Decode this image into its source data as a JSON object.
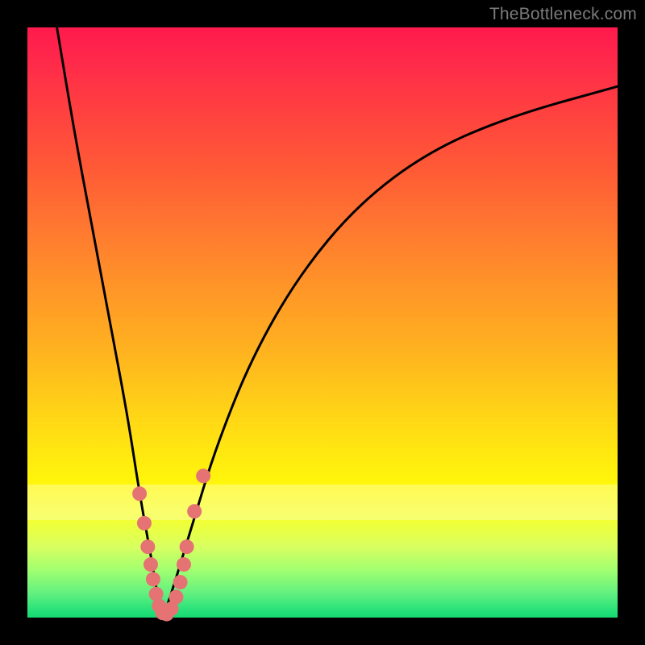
{
  "watermark": "TheBottleneck.com",
  "colors": {
    "frame_bg": "#000000",
    "curve_stroke": "#000000",
    "marker_fill": "#e57373",
    "marker_stroke": "#cc5a5a",
    "gradient_top": "#ff1a4d",
    "gradient_bottom": "#18d870"
  },
  "chart_data": {
    "type": "line",
    "title": "",
    "xlabel": "",
    "ylabel": "",
    "xlim": [
      0,
      100
    ],
    "ylim": [
      0,
      100
    ],
    "notes": "V-shaped bottleneck curve. x is a normalized hardware-balance axis (0–100). y is bottleneck percentage (0 at bottom = no bottleneck, 100 at top = severe). Minimum at roughly x≈23. Values estimated visually.",
    "series": [
      {
        "name": "left-branch",
        "x": [
          5,
          8,
          11,
          14,
          17,
          19,
          21,
          22,
          23
        ],
        "values": [
          100,
          82,
          66,
          50,
          34,
          21,
          10,
          4,
          0
        ]
      },
      {
        "name": "right-branch",
        "x": [
          23,
          25,
          28,
          32,
          38,
          46,
          56,
          68,
          82,
          100
        ],
        "values": [
          0,
          6,
          16,
          29,
          44,
          58,
          70,
          79,
          85,
          90
        ]
      }
    ],
    "markers": {
      "name": "highlighted-points",
      "comment": "salmon-colored dots clustered near the trough on both branches",
      "points": [
        {
          "x": 19.0,
          "y": 21
        },
        {
          "x": 19.8,
          "y": 16
        },
        {
          "x": 20.4,
          "y": 12
        },
        {
          "x": 20.9,
          "y": 9
        },
        {
          "x": 21.3,
          "y": 6.5
        },
        {
          "x": 21.8,
          "y": 4
        },
        {
          "x": 22.3,
          "y": 2
        },
        {
          "x": 22.9,
          "y": 0.8
        },
        {
          "x": 23.6,
          "y": 0.6
        },
        {
          "x": 24.4,
          "y": 1.5
        },
        {
          "x": 25.2,
          "y": 3.5
        },
        {
          "x": 25.9,
          "y": 6
        },
        {
          "x": 26.5,
          "y": 9
        },
        {
          "x": 27.0,
          "y": 12
        },
        {
          "x": 28.3,
          "y": 18
        },
        {
          "x": 29.8,
          "y": 24
        }
      ]
    }
  }
}
